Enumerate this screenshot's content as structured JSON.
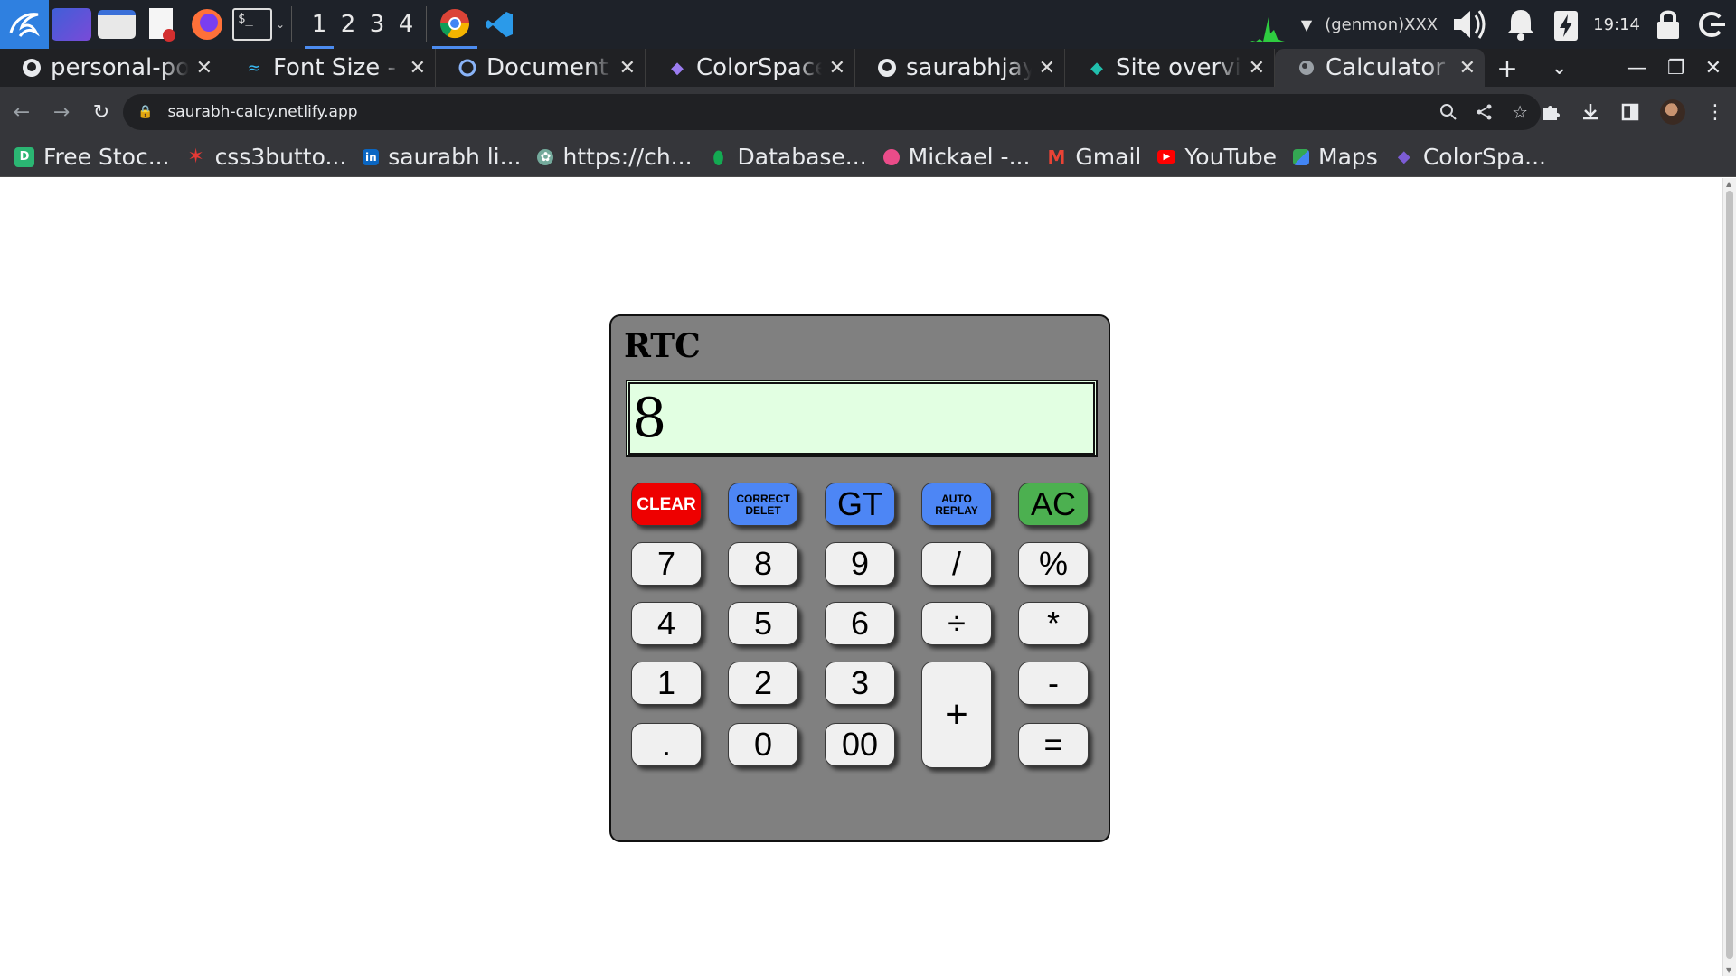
{
  "taskbar": {
    "workspaces": [
      "1",
      "2",
      "3",
      "4"
    ],
    "genmon_text": "(genmon)XXX",
    "clock": "19:14"
  },
  "tabs": [
    {
      "title": "personal-portfolio",
      "icon": "github-icon"
    },
    {
      "title": "Font Size - Tailwind CSS",
      "icon": "tailwind-icon"
    },
    {
      "title": "Document",
      "icon": "globe-icon"
    },
    {
      "title": "ColorSpace - Color Palettes",
      "icon": "colorspace-icon"
    },
    {
      "title": "saurabhjaykar",
      "icon": "github-icon"
    },
    {
      "title": "Site overview",
      "icon": "netlify-icon"
    },
    {
      "title": "Calculator",
      "icon": "globe-icon",
      "active": true
    }
  ],
  "address_bar": {
    "url": "saurabh-calcy.netlify.app"
  },
  "bookmarks": [
    {
      "label": "Free Stoc...",
      "icon": "d-icon",
      "color": "#2bb673"
    },
    {
      "label": "css3butto...",
      "icon": "star-icon",
      "color": "#e53935"
    },
    {
      "label": "saurabh li...",
      "icon": "linkedin-icon",
      "color": "#0a66c2"
    },
    {
      "label": "https://ch...",
      "icon": "openai-icon",
      "color": "#74aa9c"
    },
    {
      "label": "Database...",
      "icon": "mongodb-icon",
      "color": "#13aa52"
    },
    {
      "label": "Mickael -...",
      "icon": "dribbble-icon",
      "color": "#ea4c89"
    },
    {
      "label": "Gmail",
      "icon": "gmail-icon",
      "color": "#ea4335"
    },
    {
      "label": "YouTube",
      "icon": "youtube-icon",
      "color": "#ff0000"
    },
    {
      "label": "Maps",
      "icon": "maps-icon",
      "color": "#34a853"
    },
    {
      "label": "ColorSpa...",
      "icon": "colorspace-icon",
      "color": "#7c5cd6"
    }
  ],
  "calculator": {
    "brand": "RTC",
    "display_value": "8",
    "keys": {
      "clear": "CLEAR",
      "correct_line1": "CORRECT",
      "correct_line2": "DELET",
      "gt": "GT",
      "auto_line1": "AUTO",
      "auto_line2": "REPLAY",
      "ac": "AC",
      "k7": "7",
      "k8": "8",
      "k9": "9",
      "slash": "/",
      "percent": "%",
      "k4": "4",
      "k5": "5",
      "k6": "6",
      "divide": "÷",
      "multiply": "*",
      "k1": "1",
      "k2": "2",
      "k3": "3",
      "plus": "+",
      "minus": "-",
      "dot": ".",
      "k0": "0",
      "k00": "00",
      "equals": "="
    },
    "colors": {
      "body": "#808080",
      "display_bg": "#e2ffe2",
      "clear": "#ee0000",
      "blue": "#4d86f5",
      "ac": "#4cb050",
      "key": "#f0f0f0"
    }
  }
}
